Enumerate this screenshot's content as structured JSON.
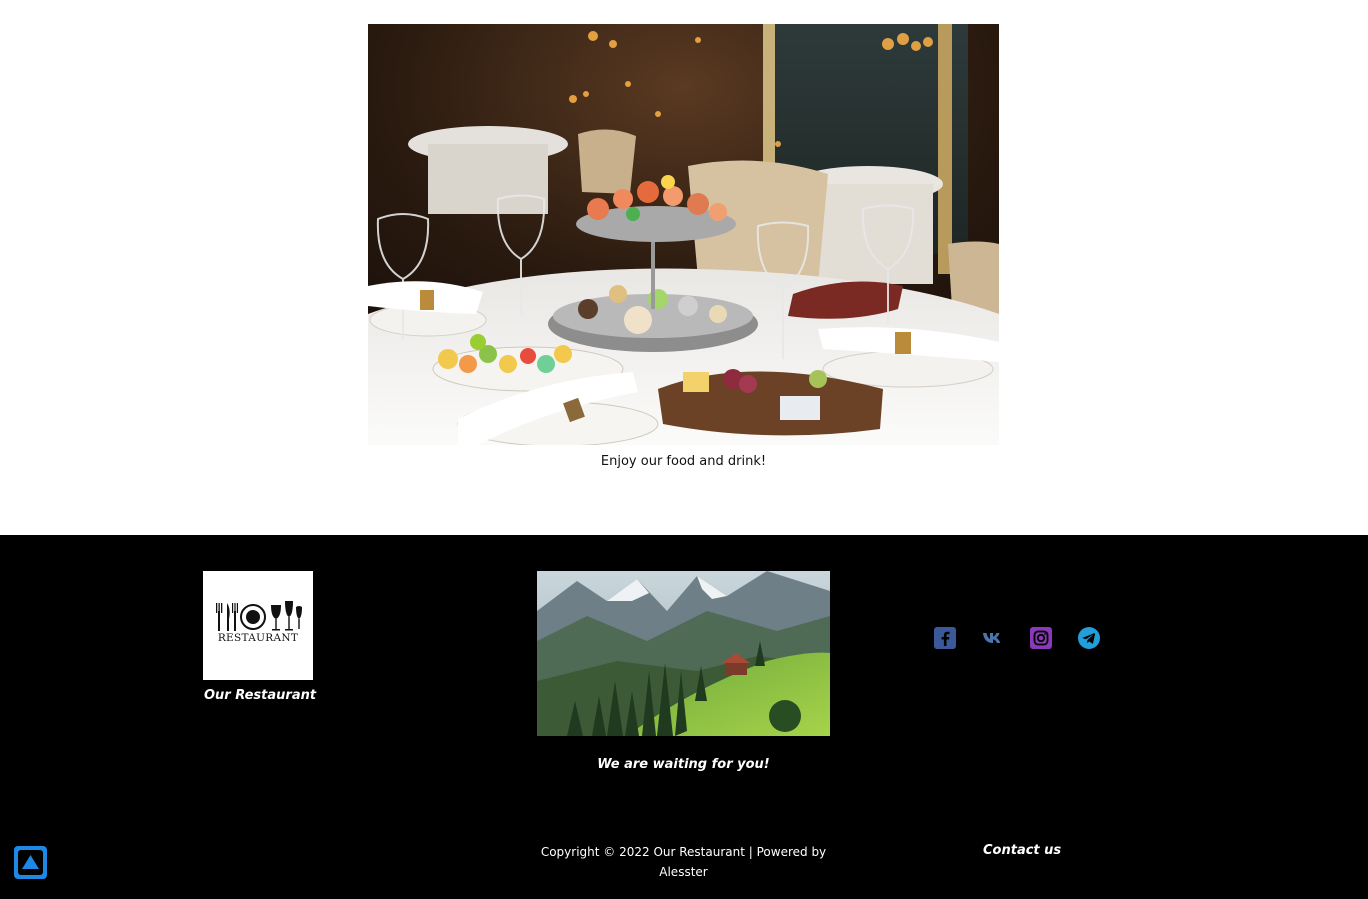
{
  "top_text": "",
  "hero": {
    "caption": "Enjoy our food and drink!"
  },
  "footer": {
    "logo_text": "RESTAURANT",
    "brand_name": "Our Restaurant",
    "tagline": "We are waiting for you!",
    "copyright_line1": "Copyright © 2022 Our Restaurant | Powered by",
    "copyright_line2": "Alesster",
    "contact_label": "Contact us",
    "socials": [
      {
        "name": "facebook-icon",
        "color": "#3b5998"
      },
      {
        "name": "vk-icon",
        "color": "#4a76a8"
      },
      {
        "name": "instagram-icon",
        "color": "#8a3ab9"
      },
      {
        "name": "telegram-icon",
        "color": "#229ed9"
      }
    ]
  },
  "colors": {
    "footer_bg": "#000000",
    "scroll_button": "#1e88e5"
  }
}
